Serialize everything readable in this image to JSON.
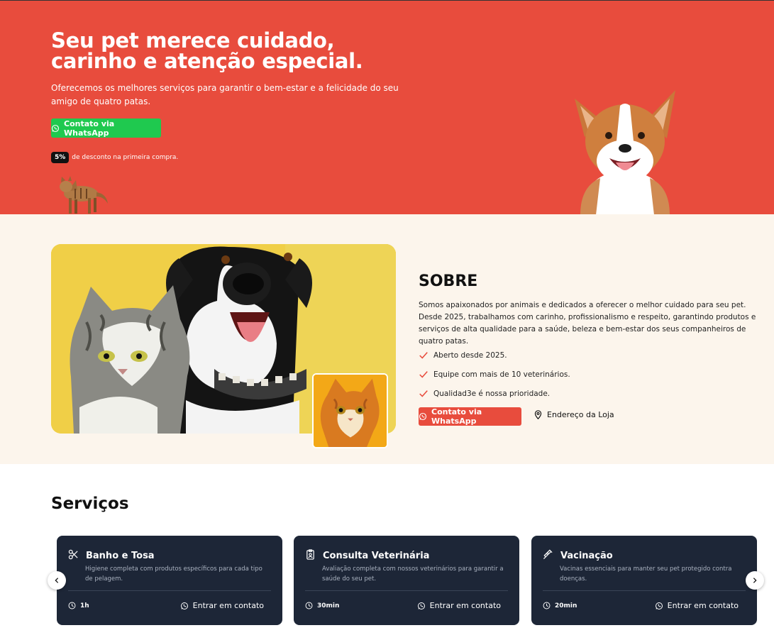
{
  "hero": {
    "title": "Seu pet merece cuidado, carinho e atenção especial.",
    "subtitle": "Oferecemos os melhores serviços para garantir o bem-estar e a felicidade do seu amigo de quatro patas.",
    "whatsapp_label": "Contato via WhatsApp",
    "promo_badge": "5%",
    "promo_text": "de desconto na primeira compra.",
    "bg_color": "#e84c3d",
    "whatsapp_color": "#1fc94f"
  },
  "about": {
    "title": "SOBRE",
    "text": "Somos apaixonados por animais e dedicados a oferecer o melhor cuidado para seu pet. Desde 2025, trabalhamos com carinho, profissionalismo e respeito, garantindo produtos e serviços de alta qualidade para a saúde, beleza e bem-estar dos seus companheiros de quatro patas.",
    "checks": [
      "Aberto desde 2025.",
      "Equipe com mais de 10 veterinários.",
      "Qualidad3e é nossa prioridade."
    ],
    "whatsapp_label": "Contato via WhatsApp",
    "address_label": "Endereço da Loja",
    "bg_color": "#fcf5ec"
  },
  "services": {
    "title": "Serviços",
    "contact_label": "Entrar em contato",
    "items": [
      {
        "icon": "scissors-icon",
        "name": "Banho e Tosa",
        "desc": "Higiene completa com produtos específicos para cada tipo de pelagem.",
        "duration": "1h"
      },
      {
        "icon": "badge-icon",
        "name": "Consulta Veterinária",
        "desc": "Avaliação completa com nossos veterinários para garantir a saúde do seu pet.",
        "duration": "30min"
      },
      {
        "icon": "syringe-icon",
        "name": "Vacinação",
        "desc": "Vacinas essenciais para manter seu pet protegido contra doenças.",
        "duration": "20min"
      }
    ],
    "card_color": "#1d2637"
  }
}
